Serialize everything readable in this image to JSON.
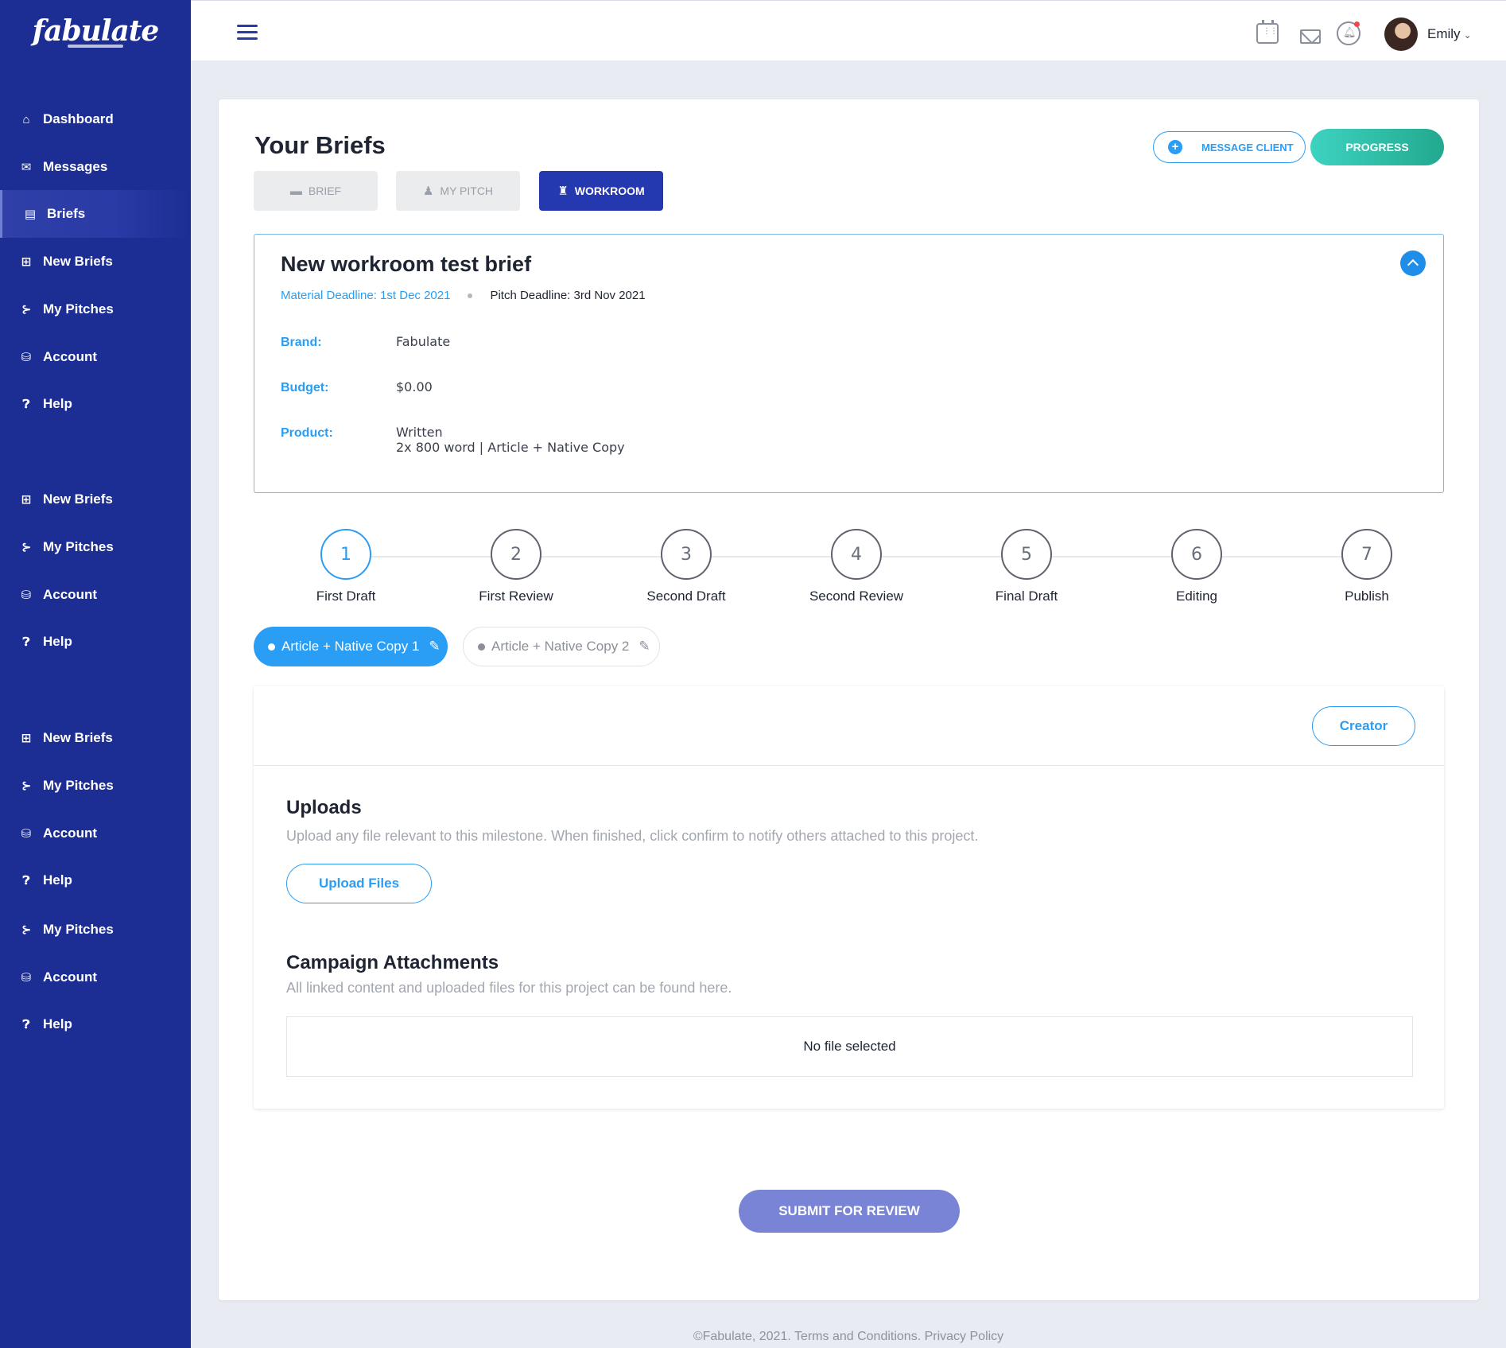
{
  "app": {
    "logo": "fabulate"
  },
  "sidebar": {
    "items": [
      {
        "label": "Dashboard",
        "icon": "home-icon"
      },
      {
        "label": "Messages",
        "icon": "envelope-icon"
      },
      {
        "label": "Briefs",
        "icon": "briefs-icon",
        "active": true
      },
      {
        "label": "New Briefs",
        "icon": "new-briefs-icon"
      },
      {
        "label": "My Pitches",
        "icon": "pitches-icon"
      },
      {
        "label": "Account",
        "icon": "account-icon"
      },
      {
        "label": "Help",
        "icon": "help-icon"
      },
      {
        "label": "New Briefs",
        "icon": "new-briefs-icon"
      },
      {
        "label": "My Pitches",
        "icon": "pitches-icon"
      },
      {
        "label": "Account",
        "icon": "account-icon"
      },
      {
        "label": "Help",
        "icon": "help-icon"
      },
      {
        "label": "New Briefs",
        "icon": "new-briefs-icon"
      },
      {
        "label": "My Pitches",
        "icon": "pitches-icon"
      },
      {
        "label": "Account",
        "icon": "account-icon"
      },
      {
        "label": "Help",
        "icon": "help-icon"
      },
      {
        "label": "My Pitches",
        "icon": "pitches-icon"
      },
      {
        "label": "Account",
        "icon": "account-icon"
      },
      {
        "label": "Help",
        "icon": "help-icon"
      }
    ]
  },
  "topbar": {
    "user_name": "Emily"
  },
  "page": {
    "title": "Your Briefs",
    "message_client_label": "MESSAGE CLIENT",
    "progress_label": "PROGRESS",
    "tabs": [
      {
        "label": "BRIEF"
      },
      {
        "label": "MY PITCH"
      },
      {
        "label": "WORKROOM",
        "active": true
      }
    ]
  },
  "brief": {
    "title": "New workroom test brief",
    "material_deadline": "Material Deadline: 1st Dec 2021",
    "pitch_deadline": "Pitch Deadline: 3rd Nov 2021",
    "brand_label": "Brand:",
    "brand_value": "Fabulate",
    "budget_label": "Budget:",
    "budget_value": "$0.00",
    "product_label": "Product:",
    "product_value_line1": "Written",
    "product_value_line2": "2x 800 word | Article + Native Copy"
  },
  "steps": [
    {
      "number": "1",
      "label": "First Draft",
      "active": true
    },
    {
      "number": "2",
      "label": "First Review"
    },
    {
      "number": "3",
      "label": "Second Draft"
    },
    {
      "number": "4",
      "label": "Second Review"
    },
    {
      "number": "5",
      "label": "Final Draft"
    },
    {
      "number": "6",
      "label": "Editing"
    },
    {
      "number": "7",
      "label": "Publish"
    }
  ],
  "deliverables": [
    {
      "label": "Article + Native Copy 1",
      "active": true
    },
    {
      "label": "Article + Native Copy 2"
    }
  ],
  "panel": {
    "creator_label": "Creator",
    "uploads_title": "Uploads",
    "uploads_desc": "Upload any file relevant to this milestone. When finished, click confirm to notify others attached to this project.",
    "upload_button": "Upload Files",
    "attachments_title": "Campaign Attachments",
    "attachments_desc": "All linked content and uploaded files for this project can be found here.",
    "no_file": "No file selected"
  },
  "submit_label": "SUBMIT FOR REVIEW",
  "footer": {
    "copyright": "©Fabulate, 2021.",
    "terms": "Terms and Conditions.",
    "privacy": "Privacy Policy"
  }
}
